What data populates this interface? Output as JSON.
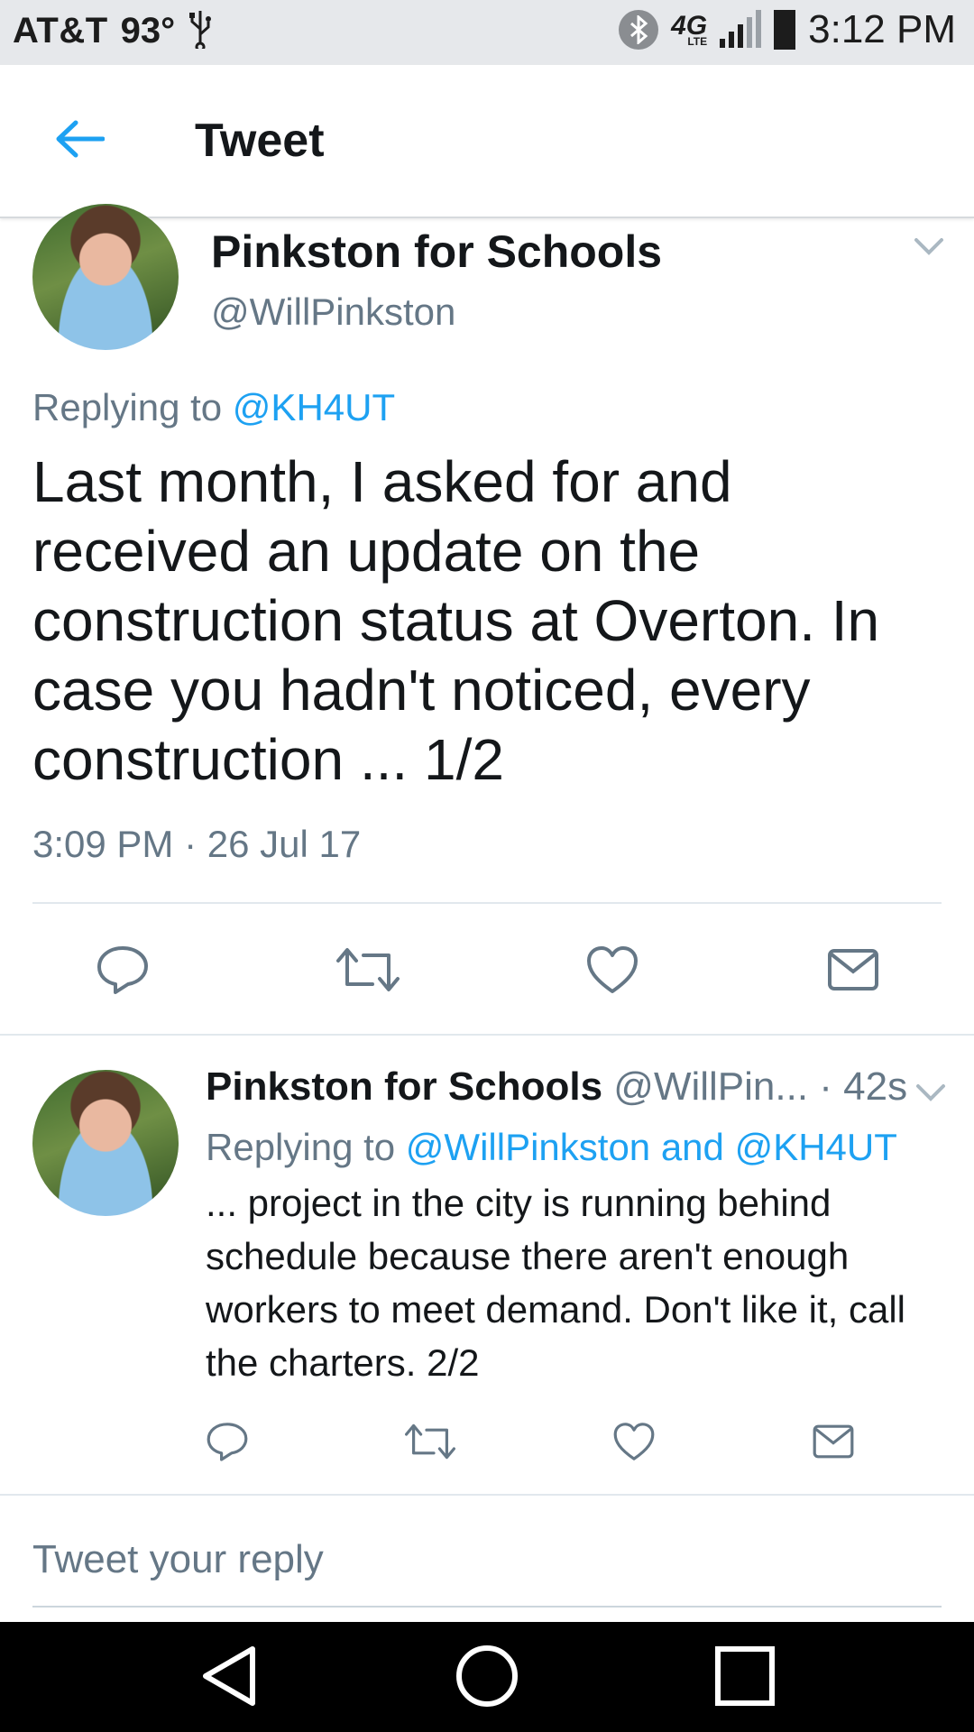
{
  "status_bar": {
    "carrier": "AT&T",
    "temperature": "93°",
    "time": "3:12 PM",
    "network": "4G",
    "network_sub": "LTE"
  },
  "header": {
    "title": "Tweet",
    "back_icon": "arrow-left-icon"
  },
  "main_tweet": {
    "name": "Pinkston for Schools",
    "handle": "@WillPinkston",
    "replying_prefix": "Replying to",
    "replying_to": "@KH4UT",
    "text": "Last month, I asked for and received an update on the construction status at Overton. In case you hadn't noticed, every construction ... 1/2",
    "timestamp": "3:09 PM · 26 Jul 17",
    "actions": [
      "reply-icon",
      "retweet-icon",
      "like-icon",
      "dm-icon"
    ]
  },
  "reply_tweet": {
    "name": "Pinkston for Schools",
    "handle_time": "@WillPin... · 42s",
    "replying_prefix": "Replying to",
    "replying_to": "@WillPinkston and @KH4UT",
    "text": "... project in the city is running behind schedule because there aren't enough workers to meet demand. Don't like it, call the charters. 2/2",
    "actions": [
      "reply-icon",
      "retweet-icon",
      "like-icon",
      "dm-icon"
    ]
  },
  "reply_box": {
    "placeholder": "Tweet your reply"
  },
  "colors": {
    "accent": "#1da1f2",
    "secondary_text": "#657786",
    "primary_text": "#14171a",
    "status_bar_bg": "#e6e8eb",
    "nav_bar_bg": "#000000"
  }
}
